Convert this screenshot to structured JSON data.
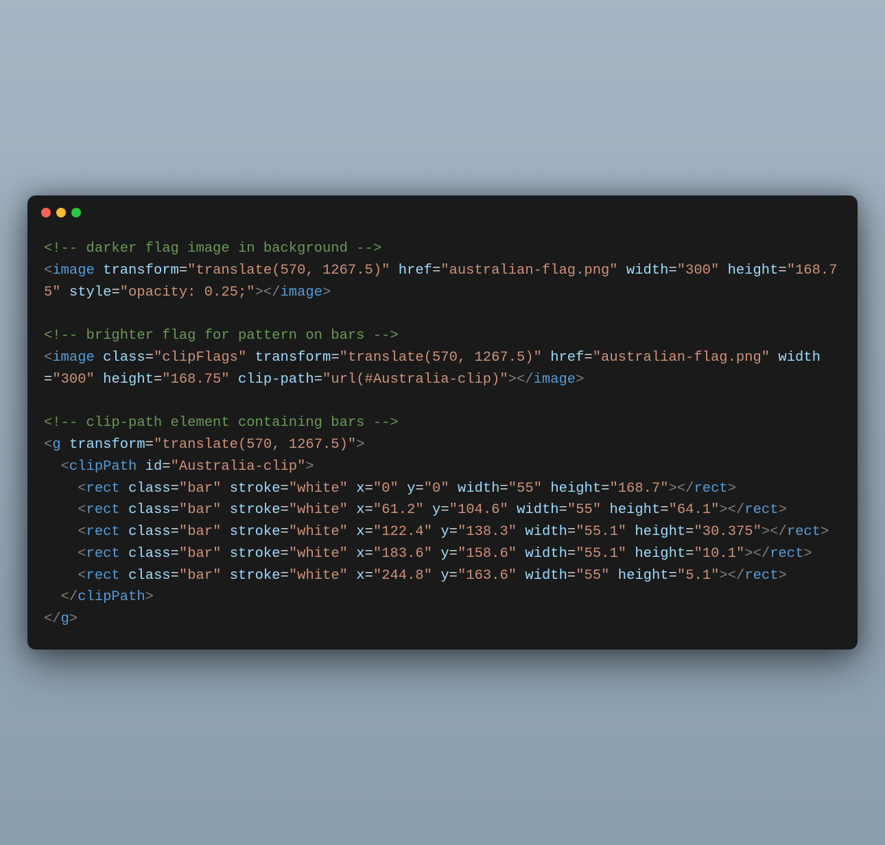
{
  "traffic_lights": {
    "red": "#ff5f57",
    "yellow": "#febc2e",
    "green": "#28c840"
  },
  "code": {
    "comment1_open": "<!--",
    "comment1_text": " darker flag image in background ",
    "comment1_close": "-->",
    "l2_open": "<",
    "l2_tag": "image",
    "l2_attr_transform": "transform",
    "l2_val_transform": "\"translate(570, 1267.5)\"",
    "l2_attr_href": "href",
    "l2_val_href": "\"australian-flag.png\"",
    "l3_attr_width": "width",
    "l3_val_width": "\"300\"",
    "l3_attr_height": "height",
    "l3_val_height": "\"168.75\"",
    "l3_attr_style": "style",
    "l3_val_style": "\"opacity: 0.25;\"",
    "l3_close_open": "></",
    "l3_close_tag": "image",
    "l3_close_br": ">",
    "comment2_open": "<!--",
    "comment2_text": " brighter flag for pattern on bars ",
    "comment2_close": "-->",
    "l5_open": "<",
    "l5_tag": "image",
    "l5_attr_class": "class",
    "l5_val_class": "\"clipFlags\"",
    "l5_attr_transform": "transform",
    "l5_val_transform": "\"translate(570, 1267.5)\"",
    "l6_attr_href": "href",
    "l6_val_href": "\"australian-flag.png\"",
    "l6_attr_width": "width",
    "l6_val_width": "\"300\"",
    "l6_attr_height": "height",
    "l6_val_height": "\"168.75\"",
    "l6_attr_clippath": "clip-path",
    "l7_val_clippath": "\"url(#Australia-clip)\"",
    "l7_close_open": "></",
    "l7_close_tag": "image",
    "l7_close_br": ">",
    "comment3_open": "<!--",
    "comment3_text": " clip-path element containing bars ",
    "comment3_close": "-->",
    "l9_open": "<",
    "l9_tag": "g",
    "l9_attr_transform": "transform",
    "l9_val_transform": "\"translate(570, 1267.5)\"",
    "l9_close": ">",
    "l10_open": "<",
    "l10_tag": "clipPath",
    "l10_attr_id": "id",
    "l10_val_id": "\"Australia-clip\"",
    "l10_close": ">",
    "rect_attr_class": "class",
    "rect_val_class": "\"bar\"",
    "rect_attr_stroke": "stroke",
    "rect_val_stroke": "\"white\"",
    "rect_attr_x": "x",
    "rect_attr_y": "y",
    "rect_attr_width": "width",
    "rect_attr_height": "height",
    "rect_open": "<",
    "rect_tag": "rect",
    "rect_close_open": "></",
    "rect_close_br": ">",
    "r1_x": "\"0\"",
    "r1_y": "\"0\"",
    "r1_w": "\"55\"",
    "r1_h": "\"168.7\"",
    "r2_x": "\"61.2\"",
    "r2_y": "\"104.6\"",
    "r2_w": "\"55\"",
    "r2_h": "\"64.1\"",
    "r3_x": "\"122.4\"",
    "r3_y": "\"138.3\"",
    "r3_w": "\"55.1\"",
    "r3_h": "\"30.375\"",
    "r4_x": "\"183.6\"",
    "r4_y": "\"158.6\"",
    "r4_w": "\"55.1\"",
    "r4_h": "\"10.1\"",
    "r5_x": "\"244.8\"",
    "r5_y": "\"163.6\"",
    "r5_w": "\"55\"",
    "r5_h": "\"5.1\"",
    "clippath_close_open": "</",
    "clippath_close_tag": "clipPath",
    "clippath_close_br": ">",
    "g_close_open": "</",
    "g_close_tag": "g",
    "g_close_br": ">",
    "eq": "=",
    "sp": " ",
    "indent1": "  ",
    "indent2": "    "
  }
}
